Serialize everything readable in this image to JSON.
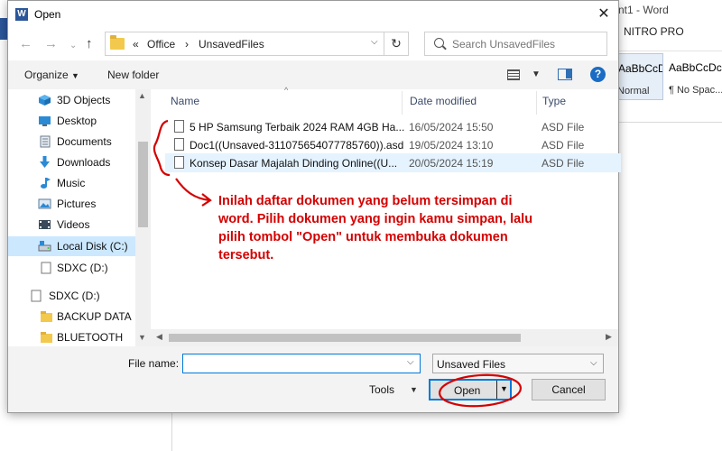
{
  "background_window": {
    "title": "nt1 - Word",
    "ribbon_tab": "NITRO PRO",
    "styles": [
      {
        "sample": "AaBbCcDc",
        "name": "Normal"
      },
      {
        "sample": "AaBbCcDc",
        "name": "¶ No Spac..."
      }
    ],
    "accent": "#2b579a"
  },
  "dialog": {
    "title": "Open",
    "close_icon": "close-icon",
    "address": {
      "overflow": "«",
      "segments": [
        "Office",
        "UnsavedFiles"
      ]
    },
    "search": {
      "placeholder": "Search UnsavedFiles"
    },
    "toolbar": {
      "organize": "Organize",
      "new_folder": "New folder"
    },
    "nav_items": [
      {
        "label": "3D Objects",
        "icon": "cube-icon"
      },
      {
        "label": "Desktop",
        "icon": "desktop-icon"
      },
      {
        "label": "Documents",
        "icon": "documents-icon"
      },
      {
        "label": "Downloads",
        "icon": "download-icon"
      },
      {
        "label": "Music",
        "icon": "music-icon"
      },
      {
        "label": "Pictures",
        "icon": "pictures-icon"
      },
      {
        "label": "Videos",
        "icon": "videos-icon"
      },
      {
        "label": "Local Disk (C:)",
        "icon": "disk-icon",
        "selected": true
      },
      {
        "label": "SDXC (D:)",
        "icon": "drive-icon"
      },
      {
        "label": "SDXC (D:)",
        "icon": "drive-icon"
      },
      {
        "label": "BACKUP DATA",
        "icon": "folder-icon"
      },
      {
        "label": "BLUETOOTH",
        "icon": "folder-icon"
      }
    ],
    "columns": {
      "name": "Name",
      "date": "Date modified",
      "type": "Type"
    },
    "files": [
      {
        "name": "5 HP Samsung Terbaik 2024 RAM 4GB Ha...",
        "date": "16/05/2024 15:50",
        "type": "ASD File"
      },
      {
        "name": "Doc1((Unsaved-311075654077785760)).asd",
        "date": "19/05/2024 13:10",
        "type": "ASD File"
      },
      {
        "name": "Konsep Dasar Majalah Dinding Online((U...",
        "date": "20/05/2024 15:19",
        "type": "ASD File",
        "selected": true
      }
    ],
    "file_name_label": "File name:",
    "file_name_value": "",
    "file_type": "Unsaved Files",
    "tools": "Tools",
    "open": "Open",
    "cancel": "Cancel"
  },
  "annotation": {
    "text": "Inilah daftar dokumen yang belum tersimpan di word. Pilih dokumen yang ingin kamu simpan, lalu pilih tombol \"Open\" untuk membuka dokumen tersebut.",
    "color": "#d40000"
  }
}
